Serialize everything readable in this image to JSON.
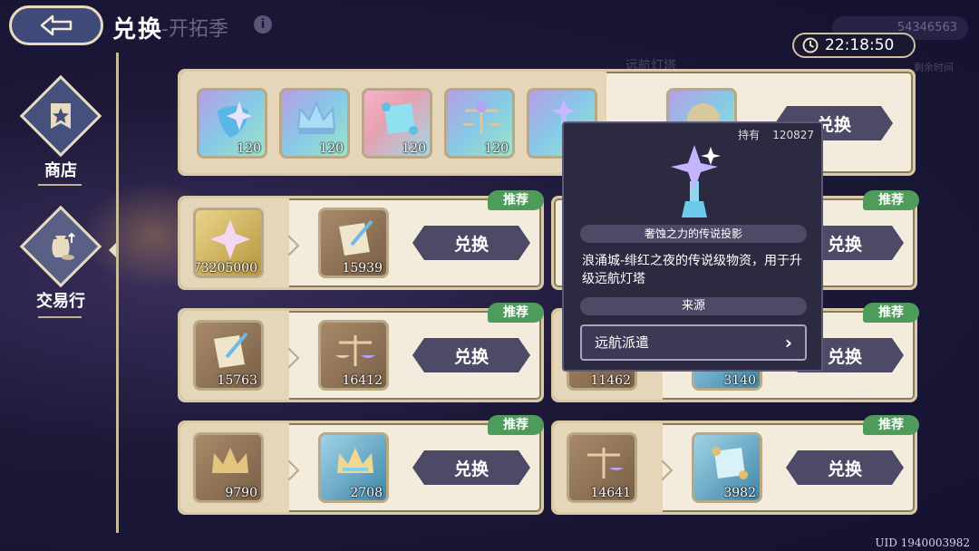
{
  "header": {
    "title": "兑换",
    "subtitle": "-开拓季",
    "currency_amount": "54346563",
    "timer": "22:18:50",
    "bg_text_1": "远航灯塔",
    "bg_text_2": "剩余时间"
  },
  "sidebar": {
    "items": [
      {
        "label": "商店",
        "icon": "star-banner-icon"
      },
      {
        "label": "交易行",
        "icon": "coin-bag-icon"
      }
    ]
  },
  "top_panel": {
    "items": [
      {
        "icon": "shield-crystal",
        "qty": "120"
      },
      {
        "icon": "crown-crystal",
        "qty": "120"
      },
      {
        "icon": "scroll-crystal",
        "qty": "120"
      },
      {
        "icon": "scale-crystal",
        "qty": "120"
      },
      {
        "icon": "trophy-crystal",
        "qty": "120"
      }
    ],
    "button": "兑换"
  },
  "trades": [
    {
      "tag": "推荐",
      "from_qty": "73205000",
      "to_qty": "15939",
      "button": "兑换"
    },
    {
      "tag": "推荐",
      "from_qty": "",
      "to_qty": "",
      "button": "兑换"
    },
    {
      "tag": "推荐",
      "from_qty": "15763",
      "to_qty": "16412",
      "button": "兑换"
    },
    {
      "tag": "推荐",
      "from_qty": "11462",
      "to_qty": "3140",
      "button": "兑换"
    },
    {
      "tag": "推荐",
      "from_qty": "9790",
      "to_qty": "2708",
      "button": "兑换"
    },
    {
      "tag": "推荐",
      "from_qty": "14641",
      "to_qty": "3982",
      "button": "兑换"
    }
  ],
  "tooltip": {
    "hold_label": "持有",
    "hold_value": "120827",
    "item_name": "奢蚀之力的传说投影",
    "description": "浪涌城-绯红之夜的传说级物资，用于升级远航灯塔",
    "source_label": "来源",
    "source_button": "远航派遣"
  },
  "footer": {
    "uid": "UID 1940003982"
  }
}
